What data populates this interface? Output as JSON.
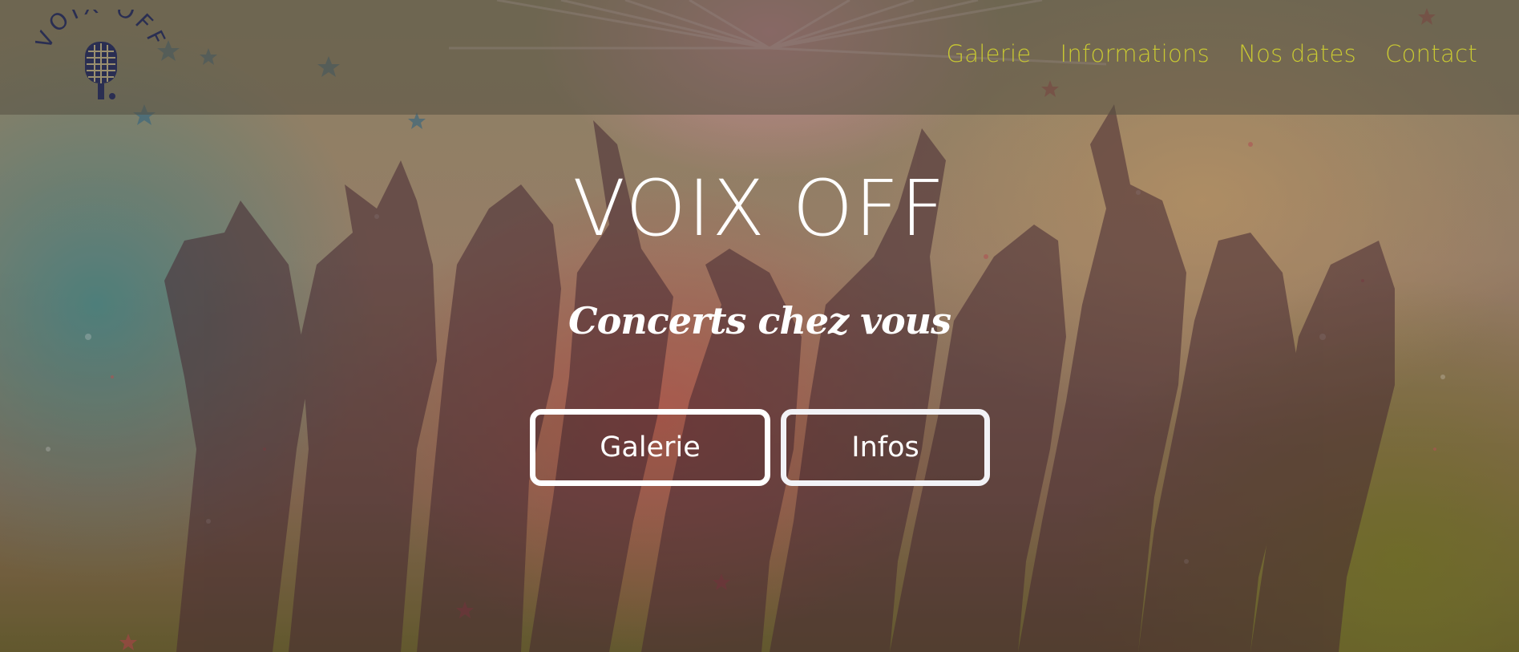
{
  "logo": {
    "text": "VOIX OFF",
    "icon": "microphone-icon"
  },
  "nav": {
    "items": [
      {
        "label": "Galerie"
      },
      {
        "label": "Informations"
      },
      {
        "label": "Nos dates"
      },
      {
        "label": "Contact"
      }
    ]
  },
  "hero": {
    "title": "VOIX OFF",
    "subtitle": "Concerts chez vous",
    "buttons": [
      {
        "label": "Galerie"
      },
      {
        "label": "Infos"
      }
    ]
  },
  "colors": {
    "nav_link": "#c8c832",
    "logo": "#2a2e52",
    "hero_text": "#ffffff"
  }
}
